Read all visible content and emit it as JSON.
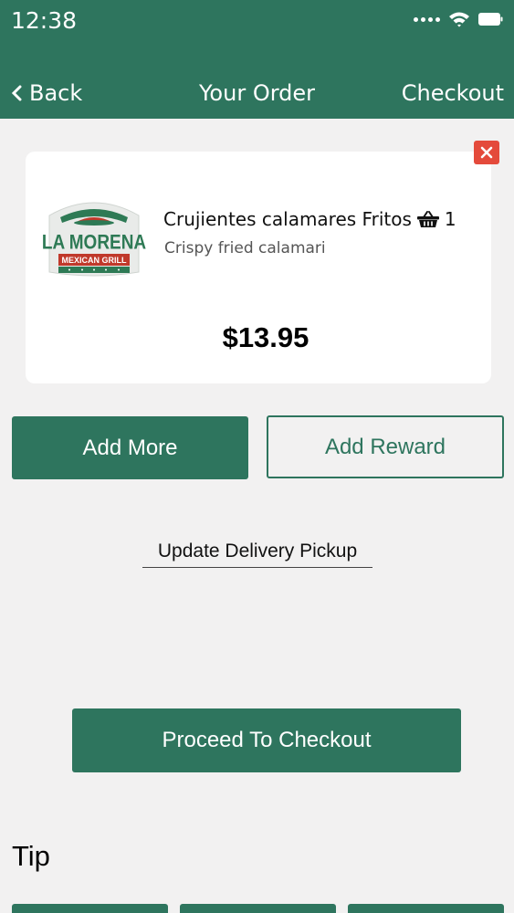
{
  "status_bar": {
    "time": "12:38"
  },
  "nav": {
    "back_label": "Back",
    "title": "Your Order",
    "checkout_label": "Checkout"
  },
  "order_item": {
    "logo_line1": "LA MORENA",
    "logo_line2": "MEXICAN GRILL",
    "name": "Crujientes calamares Fritos",
    "quantity": "1",
    "description": "Crispy fried calamari",
    "price": "$13.95"
  },
  "actions": {
    "add_more_label": "Add More",
    "add_reward_label": "Add Reward",
    "update_delivery_label": "Update Delivery Pickup",
    "proceed_label": "Proceed To Checkout"
  },
  "tip": {
    "label": "Tip"
  },
  "colors": {
    "accent": "#2e755e",
    "remove": "#e44a3b",
    "background": "#f2f1f1"
  }
}
